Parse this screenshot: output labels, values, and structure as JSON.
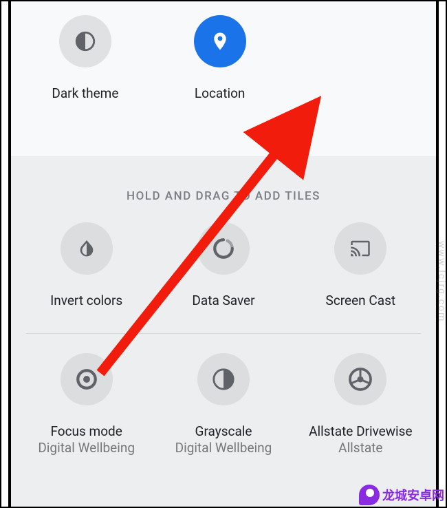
{
  "top_tiles": [
    {
      "label": "Dark theme"
    },
    {
      "label": "Location"
    }
  ],
  "section_header": "HOLD AND DRAG TO ADD TILES",
  "available_tiles_row1": [
    {
      "label": "Invert colors",
      "sublabel": ""
    },
    {
      "label": "Data Saver",
      "sublabel": ""
    },
    {
      "label": "Screen Cast",
      "sublabel": ""
    }
  ],
  "available_tiles_row2": [
    {
      "label": "Focus mode",
      "sublabel": "Digital Wellbeing"
    },
    {
      "label": "Grayscale",
      "sublabel": "Digital Wellbeing"
    },
    {
      "label": "Allstate Drivewise",
      "sublabel": "Allstate"
    }
  ],
  "watermark_side": "www.lcjrg.com",
  "watermark_bottom": "龙城安卓网"
}
